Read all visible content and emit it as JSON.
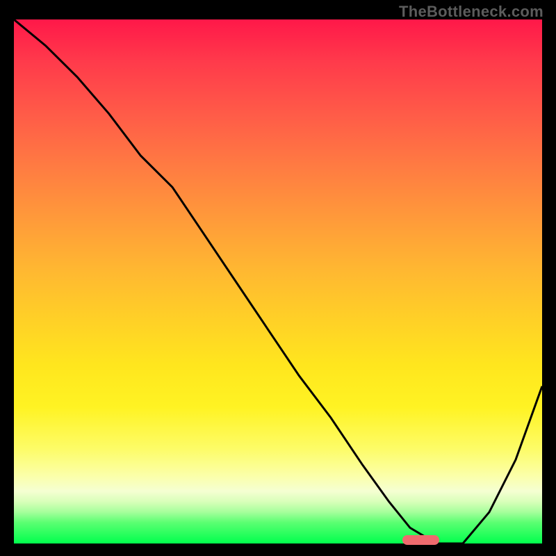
{
  "watermark": "TheBottleneck.com",
  "colors": {
    "background": "#000000",
    "watermark": "#5c5c5c",
    "curve": "#000000",
    "marker": "#ef6a6e"
  },
  "chart_data": {
    "type": "line",
    "title": "",
    "xlabel": "",
    "ylabel": "",
    "xlim": [
      0,
      100
    ],
    "ylim": [
      0,
      100
    ],
    "series": [
      {
        "name": "bottleneck-curve",
        "x": [
          0,
          6,
          12,
          18,
          24,
          30,
          36,
          42,
          48,
          54,
          60,
          66,
          71,
          75,
          80,
          85,
          90,
          95,
          100
        ],
        "values": [
          100,
          95,
          89,
          82,
          74,
          68,
          59,
          50,
          41,
          32,
          24,
          15,
          8,
          3,
          0,
          0,
          6,
          16,
          30
        ]
      }
    ],
    "marker": {
      "x_center": 77,
      "y": 0,
      "width": 7
    },
    "gradient_stops": [
      {
        "pct": 0,
        "color": "#ff1849"
      },
      {
        "pct": 18,
        "color": "#ff5b48"
      },
      {
        "pct": 38,
        "color": "#ff9a3a"
      },
      {
        "pct": 58,
        "color": "#ffd226"
      },
      {
        "pct": 82,
        "color": "#fdfc68"
      },
      {
        "pct": 92,
        "color": "#d9ffba"
      },
      {
        "pct": 100,
        "color": "#00ff4d"
      }
    ]
  }
}
